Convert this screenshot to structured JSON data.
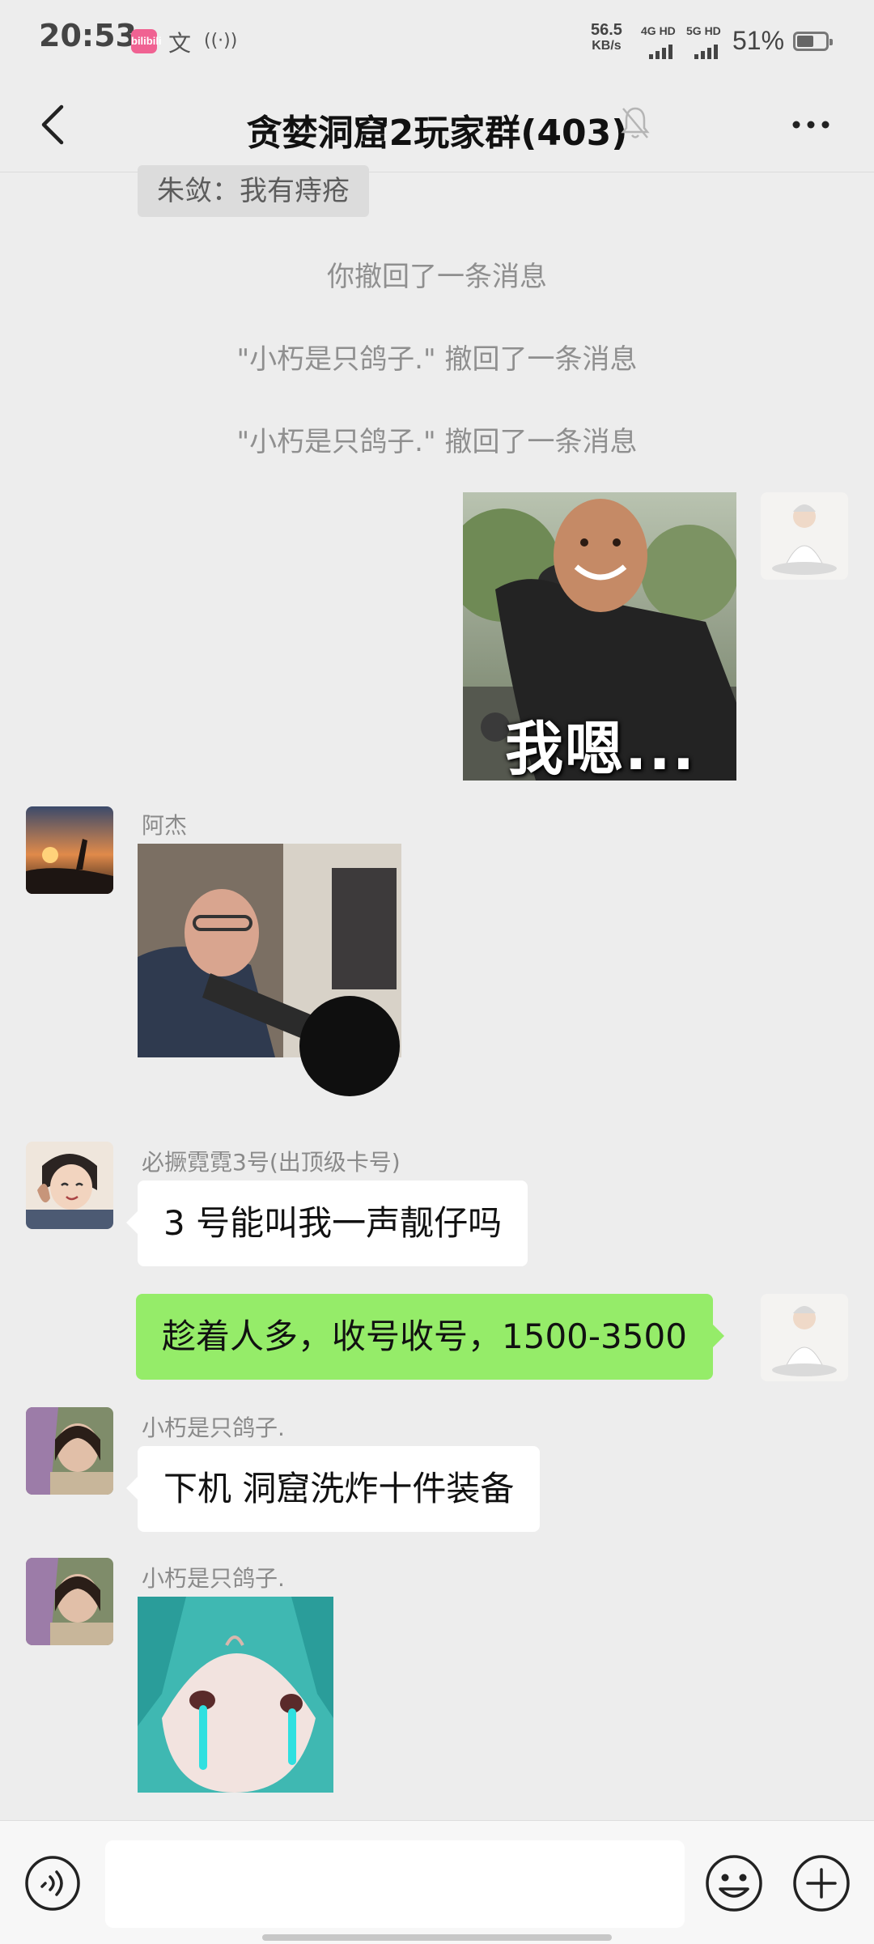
{
  "status_bar": {
    "time": "20:53",
    "app_icon_text": "bilibili",
    "symbol_1": "文",
    "symbol_2": "((·))",
    "net_speed_value": "56.5",
    "net_speed_unit": "KB/s",
    "signal_1": "4G HD",
    "signal_2": "5G HD",
    "battery": "51%"
  },
  "header": {
    "title": "贪婪洞窟2玩家群(403)",
    "icons": [
      "back-arrow-icon",
      "mute-bell-icon",
      "more-dots-icon"
    ]
  },
  "messages": {
    "quote_text": "朱敛：我有痔疮",
    "sys_1": "你撤回了一条消息",
    "sys_2": "\"小朽是只鸽子.\" 撤回了一条消息",
    "sys_3": "\"小朽是只鸽子.\" 撤回了一条消息",
    "my_sticker_caption": "我嗯...",
    "m1_sender": "阿杰",
    "m2_sender": "必撅霓霓3号(出顶级卡号)",
    "m2_text": "3 号能叫我一声靓仔吗",
    "m3_text": "趁着人多，收号收号，1500-3500",
    "m4_sender": "小朽是只鸽子.",
    "m4_text": "下机  洞窟洗炸十件装备",
    "m5_sender": "小朽是只鸽子."
  },
  "input_bar": {
    "placeholder": "",
    "icons": [
      "voice-icon",
      "emoji-icon",
      "plus-icon"
    ]
  },
  "colors": {
    "background": "#ededed",
    "my_bubble": "#95ec69",
    "other_bubble": "#ffffff",
    "system_text": "#8f8f8f"
  }
}
